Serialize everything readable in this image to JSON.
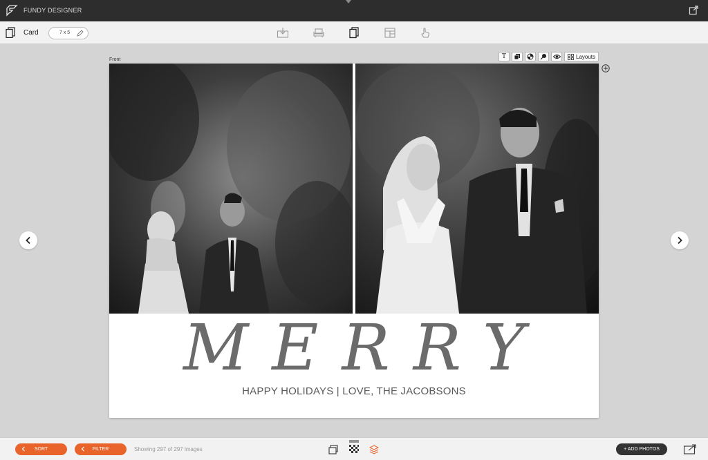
{
  "titlebar": {
    "app_title": "FUNDY DESIGNER"
  },
  "toolbar": {
    "product_label": "Card",
    "size_label": "7 x 5",
    "tools": [
      "import-icon",
      "couch-icon",
      "card-icon",
      "layout-icon",
      "hand-pointer-icon"
    ]
  },
  "canvas": {
    "page_label": "Front",
    "mini_tools": {
      "text_glyph": "T",
      "layouts_label": "Layouts"
    },
    "card": {
      "headline": "MERRY",
      "subline": "HAPPY HOLIDAYS | LOVE, THE JACOBSONS"
    }
  },
  "bottombar": {
    "sort_label": "SORT",
    "filter_label": "FILTER",
    "showing_text": "Showing 297 of 297 images",
    "add_photos_label": "+ ADD PHOTOS"
  },
  "colors": {
    "accent": "#e8642a",
    "titlebar_bg": "#2d2d2d",
    "workspace_bg": "#d4d4d4",
    "headline_gray": "#6b6b6b"
  }
}
